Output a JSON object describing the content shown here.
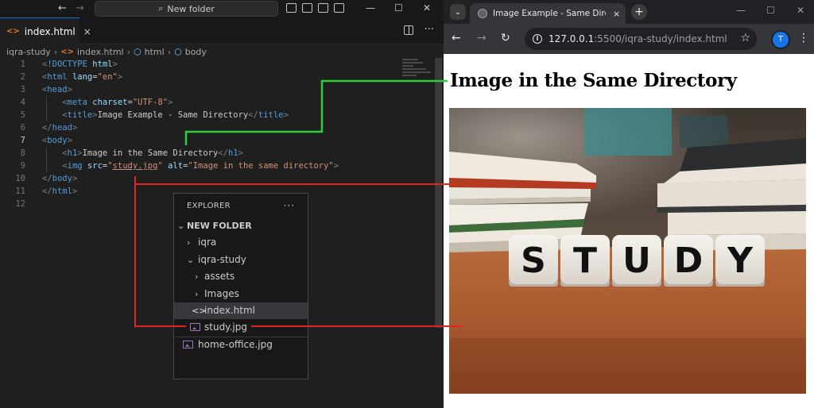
{
  "editor": {
    "search_label": "New folder",
    "tab": {
      "label": "index.html",
      "close": "×"
    },
    "breadcrumb": [
      "iqra-study",
      "index.html",
      "html",
      "body"
    ],
    "code_lines": [
      {
        "n": "1",
        "html": "<span class='t-punc'>&lt;</span><span class='t-doc'>!DOCTYPE</span> <span class='t-attr'>html</span><span class='t-punc'>&gt;</span>"
      },
      {
        "n": "2",
        "html": "<span class='t-punc'>&lt;</span><span class='t-tag'>html</span> <span class='t-attr'>lang</span>=<span class='t-val'>\"en\"</span><span class='t-punc'>&gt;</span>"
      },
      {
        "n": "3",
        "html": "<span class='t-punc'>&lt;</span><span class='t-tag'>head</span><span class='t-punc'>&gt;</span>"
      },
      {
        "n": "4",
        "html": "    <span class='t-punc'>&lt;</span><span class='t-tag'>meta</span> <span class='t-attr'>charset</span>=<span class='t-val'>\"UTF-8\"</span><span class='t-punc'>&gt;</span>"
      },
      {
        "n": "5",
        "html": "    <span class='t-punc'>&lt;</span><span class='t-tag'>title</span><span class='t-punc'>&gt;</span>Image Example - Same Directory<span class='t-punc'>&lt;/</span><span class='t-tag'>title</span><span class='t-punc'>&gt;</span>"
      },
      {
        "n": "6",
        "html": "<span class='t-punc'>&lt;/</span><span class='t-tag'>head</span><span class='t-punc'>&gt;</span>"
      },
      {
        "n": "7",
        "html": "<span class='t-punc'>&lt;</span><span class='t-tag'>body</span><span class='t-punc'>&gt;</span>"
      },
      {
        "n": "8",
        "html": "    <span class='t-punc'>&lt;</span><span class='t-tag'>h1</span><span class='t-punc'>&gt;</span>Image in the Same Directory<span class='t-punc'>&lt;/</span><span class='t-tag'>h1</span><span class='t-punc'>&gt;</span>"
      },
      {
        "n": "9",
        "html": "    <span class='t-punc'>&lt;</span><span class='t-tag'>img</span> <span class='t-attr'>src</span>=<span class='t-val'>\"<span class='t-link'>study.jpg</span>\"</span> <span class='t-attr'>alt</span>=<span class='t-val'>\"Image in the same directory\"</span><span class='t-punc'>&gt;</span>"
      },
      {
        "n": "10",
        "html": "<span class='t-punc'>&lt;/</span><span class='t-tag'>body</span><span class='t-punc'>&gt;</span>"
      },
      {
        "n": "11",
        "html": "<span class='t-punc'>&lt;/</span><span class='t-tag'>html</span><span class='t-punc'>&gt;</span>"
      },
      {
        "n": "12",
        "html": ""
      }
    ],
    "active_line": "7"
  },
  "explorer": {
    "title": "EXPLORER",
    "more": "···",
    "items": [
      {
        "label": "NEW FOLDER",
        "chev": "⌄",
        "kind": "folder-root"
      },
      {
        "label": "iqra",
        "chev": "›",
        "kind": "folder"
      },
      {
        "label": "iqra-study",
        "chev": "⌄",
        "kind": "folder"
      },
      {
        "label": "assets",
        "chev": "›",
        "kind": "folder"
      },
      {
        "label": "Images",
        "chev": "›",
        "kind": "folder"
      },
      {
        "label": "index.html",
        "chev": "",
        "kind": "html"
      },
      {
        "label": "study.jpg",
        "chev": "",
        "kind": "image"
      },
      {
        "label": "home-office.jpg",
        "chev": "",
        "kind": "image"
      }
    ]
  },
  "browser": {
    "tab_title": "Image Example - Same Directory",
    "tab_close": "×",
    "new_tab": "+",
    "url_host": "127.0.0.1",
    "url_rest": ":5500/iqra-study/index.html",
    "avatar": "T",
    "page_heading": "Image in the Same Directory",
    "image_alt": "Image in the same directory",
    "dice_letters": [
      "S",
      "T",
      "U",
      "D",
      "Y"
    ]
  },
  "colors": {
    "connector_green": "#2ecc40",
    "connector_red": "#e02424",
    "accent": "#0078d4"
  }
}
